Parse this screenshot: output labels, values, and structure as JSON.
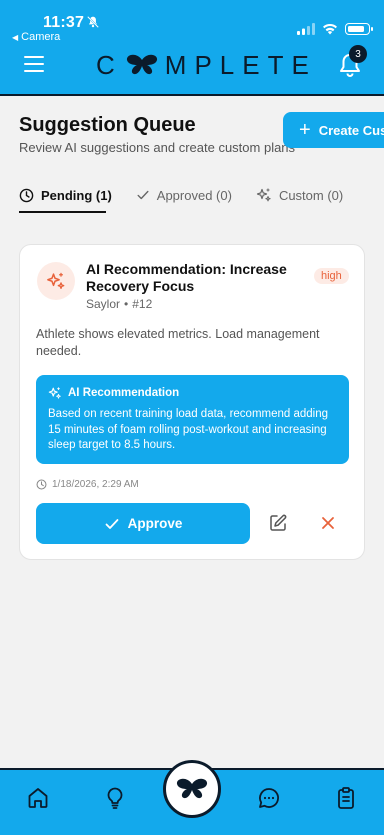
{
  "status_bar": {
    "time": "11:37",
    "back_label": "Camera"
  },
  "header": {
    "logo_text": [
      "C",
      "MPLETE"
    ],
    "notification_count": "3"
  },
  "page": {
    "title": "Suggestion Queue",
    "subtitle": "Review AI suggestions and create custom plans",
    "create_button": "Create Cus"
  },
  "tabs": [
    {
      "label": "Pending (1)",
      "icon": "clock-icon",
      "active": true
    },
    {
      "label": "Approved (0)",
      "icon": "check-icon",
      "active": false
    },
    {
      "label": "Custom (0)",
      "icon": "sparkles-icon",
      "active": false
    }
  ],
  "suggestion": {
    "title": "AI Recommendation: Increase Recovery Focus",
    "priority": "high",
    "athlete": "Saylor",
    "number": "#12",
    "description": "Athlete shows elevated metrics. Load management needed.",
    "ai_heading": "AI Recommendation",
    "ai_text": "Based on recent training load data, recommend adding 15 minutes of foam rolling post-workout and increasing sleep target to 8.5 hours.",
    "timestamp": "1/18/2026, 2:29 AM",
    "approve_label": "Approve"
  },
  "nav": [
    "home-icon",
    "lightbulb-icon",
    "butterfly-icon",
    "chat-icon",
    "clipboard-icon"
  ],
  "colors": {
    "accent": "#13a9ec",
    "dark": "#0b1b2b",
    "priority": "#e8623b"
  }
}
